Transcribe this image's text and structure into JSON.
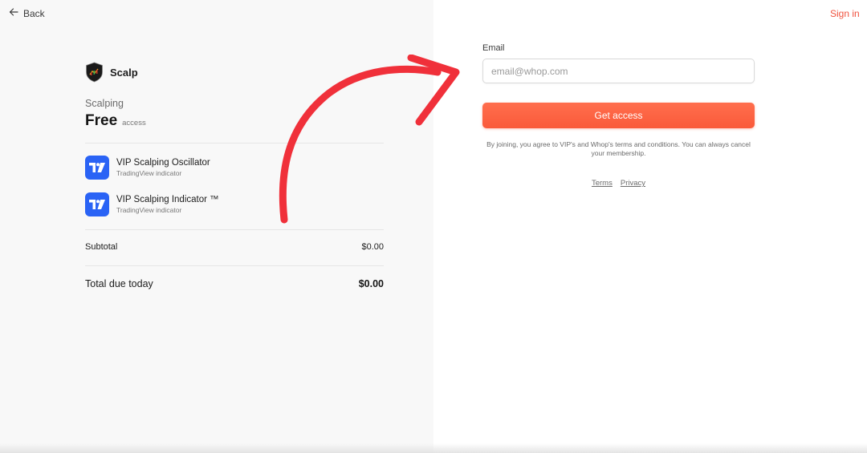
{
  "nav": {
    "back_label": "Back",
    "sign_in_label": "Sign in"
  },
  "brand": {
    "name": "Scalp",
    "logo_icon": "shield-chart-icon"
  },
  "plan": {
    "name": "Scalping",
    "price": "Free",
    "price_suffix": "access"
  },
  "products": [
    {
      "title": "VIP Scalping Oscillator",
      "subtitle": "TradingView indicator",
      "icon": "tradingview-icon"
    },
    {
      "title": "VIP Scalping Indicator ™",
      "subtitle": "TradingView indicator",
      "icon": "tradingview-icon"
    }
  ],
  "summary": {
    "subtotal_label": "Subtotal",
    "subtotal_value": "$0.00",
    "total_label": "Total due today",
    "total_value": "$0.00"
  },
  "form": {
    "email_label": "Email",
    "email_placeholder": "email@whop.com",
    "email_value": "",
    "cta_label": "Get access",
    "terms_text": "By joining, you agree to VIP's and Whop's terms and conditions. You can always cancel your membership.",
    "terms_link": "Terms",
    "privacy_link": "Privacy"
  },
  "colors": {
    "accent": "#fa5a3a",
    "arrow": "#f0303a",
    "product_icon_bg": "#2a63f5",
    "left_panel_bg": "#f8f8f8"
  }
}
